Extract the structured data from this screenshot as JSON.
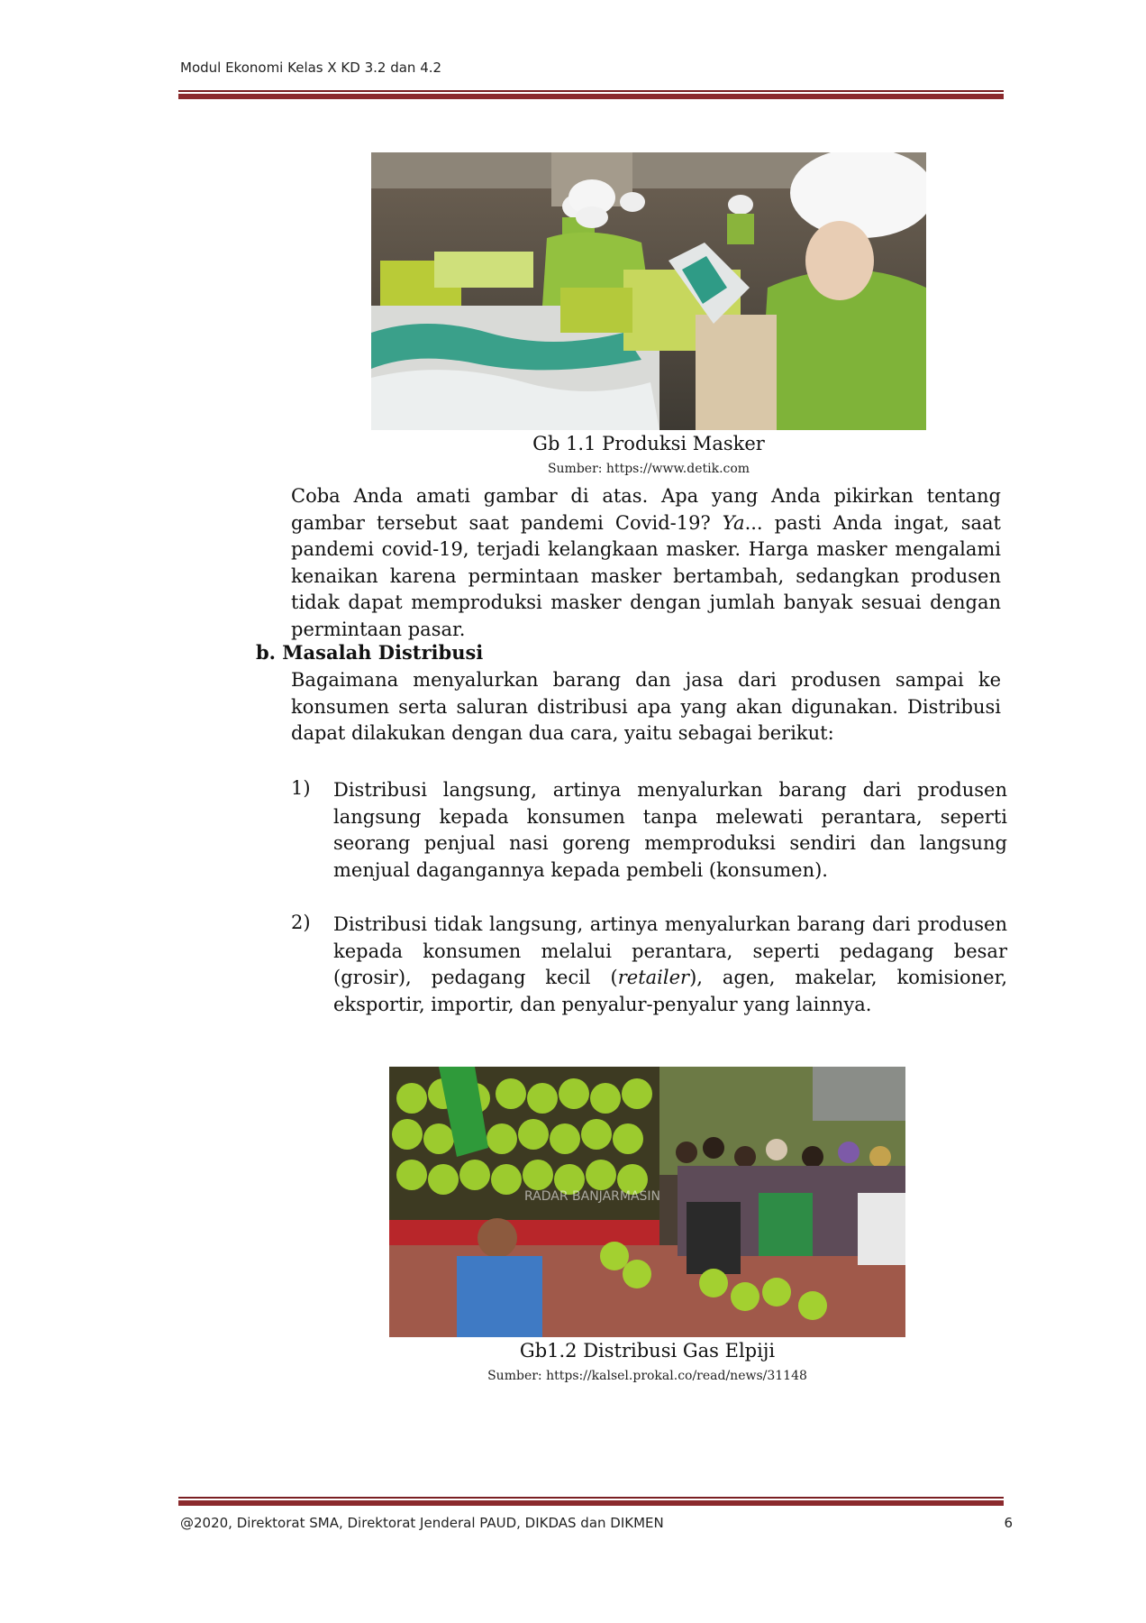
{
  "header": {
    "title": "Modul Ekonomi Kelas X KD 3.2 dan 4.2"
  },
  "figure1": {
    "caption": "Gb 1.1 Produksi Masker",
    "source": "Sumber: https://www.detik.com"
  },
  "intro": {
    "before_italic": "Coba Anda amati gambar di atas. Apa yang Anda pikirkan tentang gambar tersebut saat pandemi Covid-19? ",
    "italic": "Ya",
    "after_italic": "... pasti Anda ingat, saat pandemi covid-19, terjadi kelangkaan masker. Harga masker mengalami kenaikan karena permintaan masker bertambah, sedangkan produsen tidak dapat memproduksi masker dengan jumlah banyak sesuai dengan permintaan pasar."
  },
  "section_b": {
    "heading": "b. Masalah Distribusi",
    "text": "Bagaimana menyalurkan barang dan jasa dari produsen sampai ke konsumen serta saluran distribusi apa yang akan digunakan. Distribusi dapat dilakukan dengan dua cara, yaitu sebagai berikut:"
  },
  "list": [
    {
      "number": "1)",
      "text": "Distribusi langsung, artinya menyalurkan barang dari produsen langsung kepada konsumen tanpa melewati perantara, seperti seorang penjual nasi goreng memproduksi sendiri dan langsung menjual dagangannya kepada pembeli (konsumen)."
    },
    {
      "number": "2)",
      "before_italic": "Distribusi tidak langsung, artinya menyalurkan barang dari produsen kepada konsumen melalui perantara, seperti pedagang besar (grosir), pedagang kecil (",
      "italic": "retailer",
      "after_italic": "), agen, makelar, komisioner, eksportir, importir, dan penyalur-penyalur yang lainnya."
    }
  ],
  "figure2": {
    "watermark": "RADAR BANJARMASIN",
    "caption": "Gb1.2 Distribusi Gas Elpiji",
    "source": "Sumber: https://kalsel.prokal.co/read/news/31148"
  },
  "footer": {
    "text": "@2020, Direktorat SMA, Direktorat Jenderal PAUD, DIKDAS dan DIKMEN",
    "page_number": "6"
  }
}
